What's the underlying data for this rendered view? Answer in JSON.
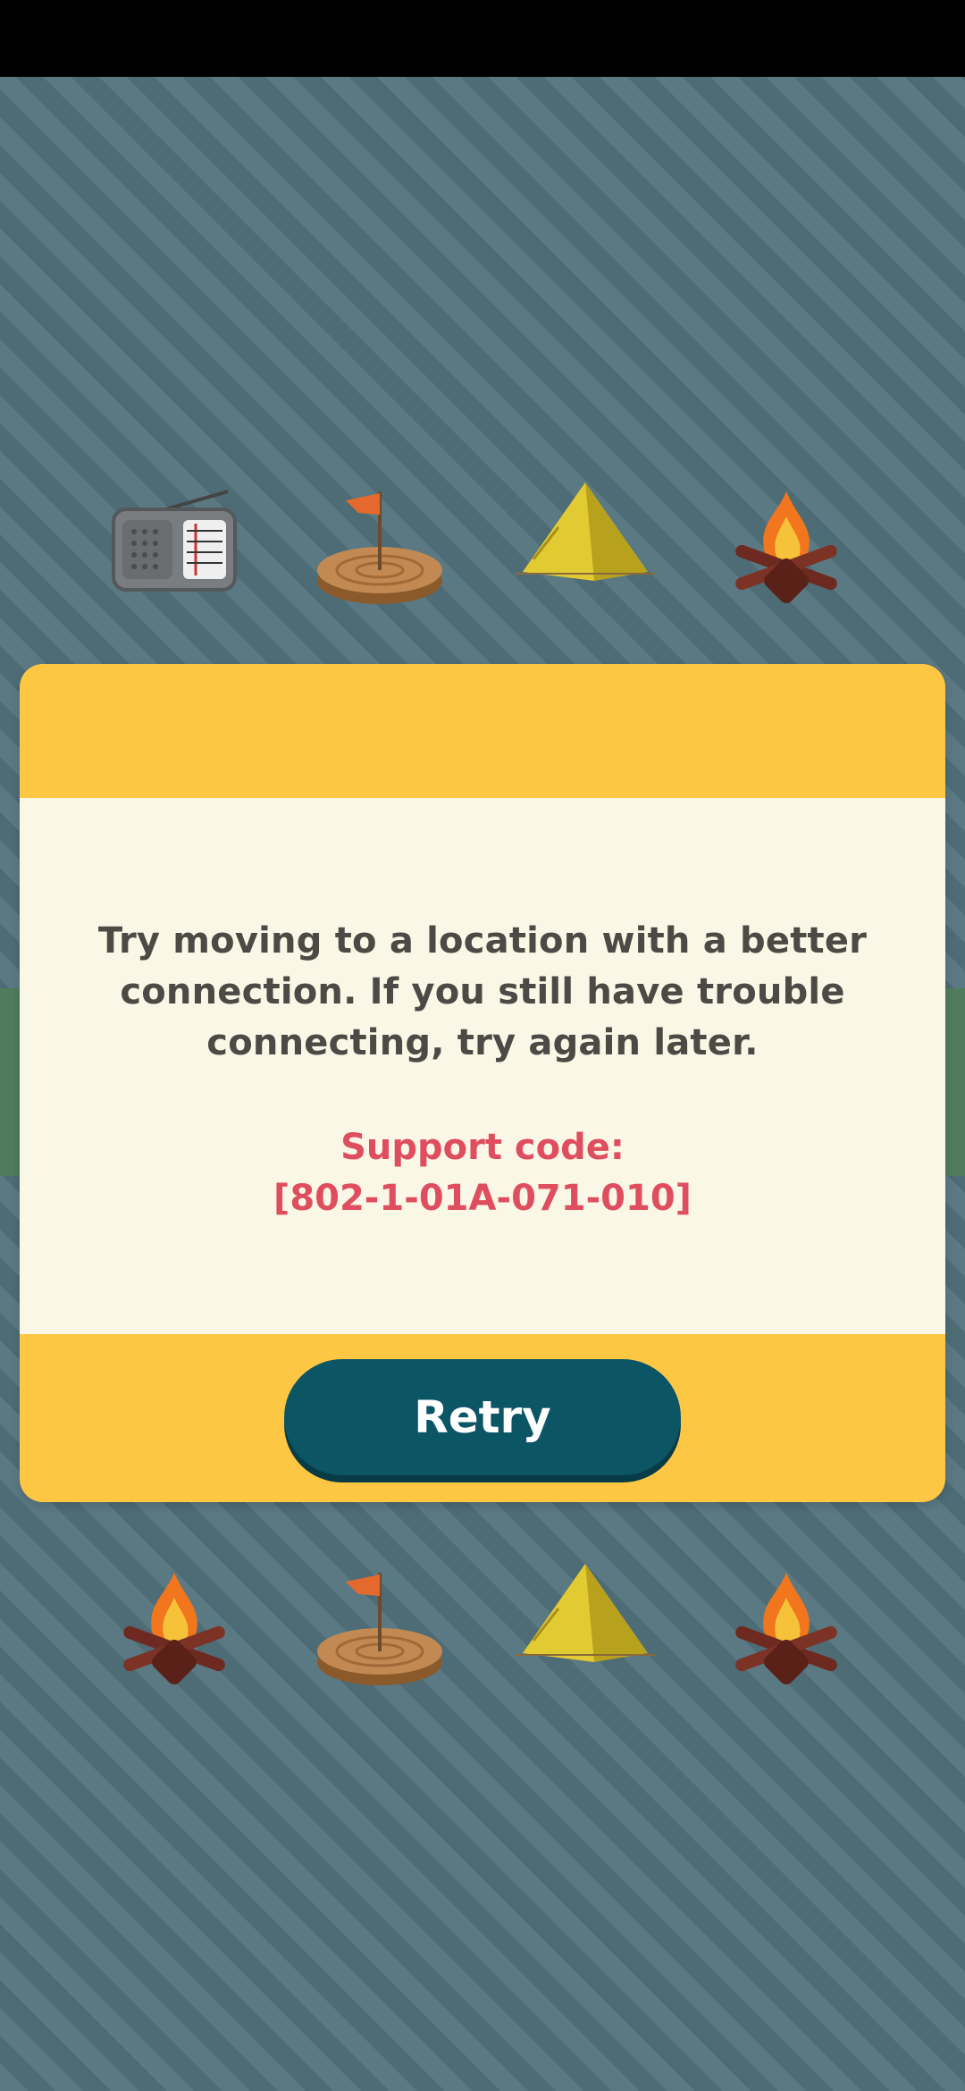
{
  "dialog": {
    "message": "Try moving to a location with a better connection. If you still have trouble connecting, try again later.",
    "support_label": "Support code:",
    "support_code": "[802-1-01A-071-010]",
    "retry_label": "Retry"
  },
  "decor": {
    "top_row": [
      "radio-icon",
      "flag-stump-icon",
      "tent-icon",
      "campfire-icon"
    ],
    "bottom_row": [
      "campfire-icon",
      "flag-stump-icon",
      "tent-icon",
      "campfire-icon"
    ]
  },
  "colors": {
    "dialog_frame": "#fec743",
    "dialog_body": "#faf7e6",
    "message_text": "#4b4a44",
    "support_text": "#df4e5e",
    "retry_button": "#0b5565",
    "background": "#577680"
  }
}
